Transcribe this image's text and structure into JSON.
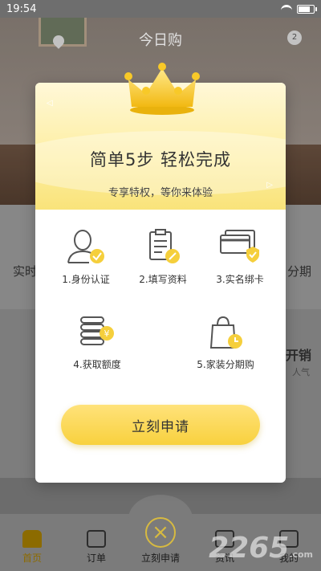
{
  "statusbar": {
    "time": "19:54"
  },
  "background": {
    "hero_title": "今日购",
    "message_badge": "2",
    "left_label": "实时",
    "right_label": "分期",
    "promo_title": "开销",
    "promo_sub": "人气"
  },
  "tabbar": {
    "home": "首页",
    "orders": "订单",
    "apply": "立刻申请",
    "news": "资讯",
    "mine": "我的"
  },
  "watermark": {
    "text": "2265",
    "domain": ".com"
  },
  "modal": {
    "title": "简单5步  轻松完成",
    "subtitle": "专享特权，等你来体验",
    "steps": [
      {
        "label": "1.身份认证",
        "icon": "id-verify-icon"
      },
      {
        "label": "2.填写资料",
        "icon": "fill-info-icon"
      },
      {
        "label": "3.实名绑卡",
        "icon": "bind-card-icon"
      },
      {
        "label": "4.获取额度",
        "icon": "get-credit-icon"
      },
      {
        "label": "5.家装分期购",
        "icon": "installment-bag-icon"
      }
    ],
    "button": "立刻申请"
  },
  "colors": {
    "accent": "#f8d13e",
    "icon_yellow": "#f5cf3c",
    "icon_stroke": "#555555"
  }
}
